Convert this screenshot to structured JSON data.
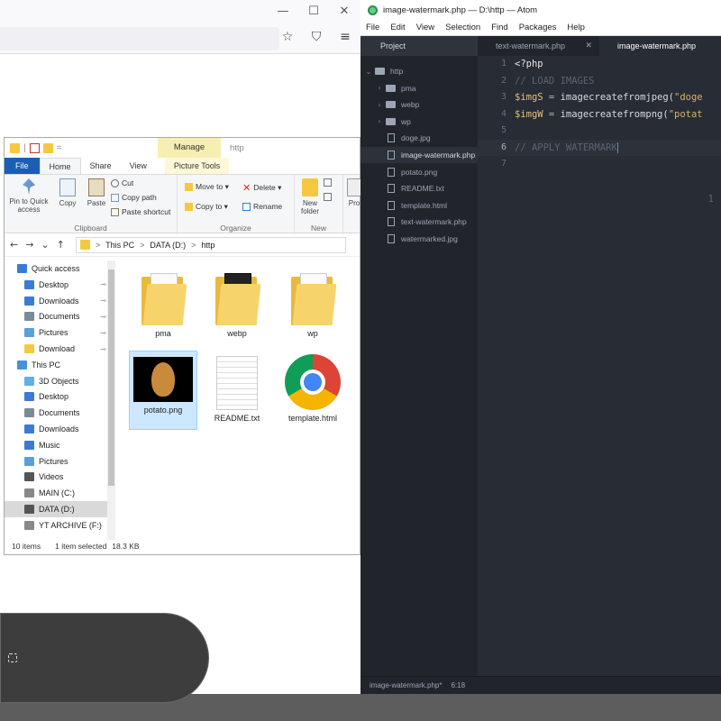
{
  "browser": {
    "win_controls": {
      "minimize": "—",
      "maximize": "☐",
      "close": "✕"
    },
    "nav_icons": [
      "star-icon",
      "pocket-icon",
      "menu-icon"
    ],
    "nav_glyphs": {
      "star": "☆",
      "pocket": "⛉",
      "menu": "≡"
    }
  },
  "explorer": {
    "manage_tab": "Manage",
    "title_path": "http",
    "ribbon_tabs": {
      "file": "File",
      "home": "Home",
      "share": "Share",
      "view": "View",
      "picture_tools": "Picture Tools"
    },
    "clipboard": {
      "pin": "Pin to Quick access",
      "copy": "Copy",
      "paste": "Paste",
      "cut": "Cut",
      "copy_path": "Copy path",
      "paste_shortcut": "Paste shortcut",
      "group": "Clipboard"
    },
    "organize": {
      "move_to": "Move to ▾",
      "copy_to": "Copy to ▾",
      "delete": "Delete ▾",
      "rename": "Rename",
      "group": "Organize"
    },
    "new": {
      "new_folder": "New folder",
      "group": "New"
    },
    "open_partial": "Pro",
    "nav": {
      "back": "←",
      "forward": "→",
      "recent": "⌄",
      "up": "↑"
    },
    "breadcrumb": [
      "This PC",
      "DATA (D:)",
      "http"
    ],
    "crumb_sep": ">",
    "navpane": [
      {
        "label": "Quick access",
        "icon": "star-icon",
        "color": "#3a7bd5",
        "pinned": false
      },
      {
        "label": "Desktop",
        "icon": "desktop-icon",
        "color": "#3a7bd5",
        "pinned": true
      },
      {
        "label": "Downloads",
        "icon": "download-icon",
        "color": "#3a7bd5",
        "pinned": true
      },
      {
        "label": "Documents",
        "icon": "document-icon",
        "color": "#7a8a99",
        "pinned": true
      },
      {
        "label": "Pictures",
        "icon": "pictures-icon",
        "color": "#5aa0d8",
        "pinned": true
      },
      {
        "label": "Download",
        "icon": "folder-icon",
        "color": "#f5c842",
        "pinned": true
      },
      {
        "label": "This PC",
        "icon": "computer-icon",
        "color": "#4a90d9",
        "pinned": false
      },
      {
        "label": "3D Objects",
        "icon": "cube-icon",
        "color": "#5fb0e6",
        "pinned": false
      },
      {
        "label": "Desktop",
        "icon": "desktop-icon",
        "color": "#3a7bd5",
        "pinned": false
      },
      {
        "label": "Documents",
        "icon": "document-icon",
        "color": "#7a8a99",
        "pinned": false
      },
      {
        "label": "Downloads",
        "icon": "download-icon",
        "color": "#3a7bd5",
        "pinned": false
      },
      {
        "label": "Music",
        "icon": "music-icon",
        "color": "#3a7bd5",
        "pinned": false
      },
      {
        "label": "Pictures",
        "icon": "pictures-icon",
        "color": "#5aa0d8",
        "pinned": false
      },
      {
        "label": "Videos",
        "icon": "video-icon",
        "color": "#555555",
        "pinned": false
      },
      {
        "label": "MAIN (C:)",
        "icon": "drive-icon",
        "color": "#888888",
        "pinned": false
      },
      {
        "label": "DATA (D:)",
        "icon": "drive-icon",
        "color": "#555555",
        "pinned": false
      },
      {
        "label": "YT ARCHIVE (F:)",
        "icon": "drive-icon",
        "color": "#888888",
        "pinned": false
      }
    ],
    "pin_glyph": "⊸",
    "files": [
      {
        "name": "pma",
        "kind": "folder"
      },
      {
        "name": "webp",
        "kind": "folder-dark"
      },
      {
        "name": "wp",
        "kind": "folder"
      },
      {
        "name": "potato.png",
        "kind": "image"
      },
      {
        "name": "README.txt",
        "kind": "text"
      },
      {
        "name": "template.html",
        "kind": "chrome"
      }
    ],
    "status": {
      "count": "10 items",
      "selection": "1 item selected",
      "size": "18.3 KB"
    }
  },
  "atom": {
    "title": "image-watermark.php — D:\\http — Atom",
    "menu": [
      "File",
      "Edit",
      "View",
      "Selection",
      "Find",
      "Packages",
      "Help"
    ],
    "project_label": "Project",
    "tree": [
      {
        "label": "http",
        "type": "root"
      },
      {
        "label": "pma",
        "type": "folder"
      },
      {
        "label": "webp",
        "type": "folder"
      },
      {
        "label": "wp",
        "type": "folder"
      },
      {
        "label": "doge.jpg",
        "type": "file"
      },
      {
        "label": "image-watermark.php",
        "type": "file",
        "selected": true
      },
      {
        "label": "potato.png",
        "type": "file"
      },
      {
        "label": "README.txt",
        "type": "file"
      },
      {
        "label": "template.html",
        "type": "file"
      },
      {
        "label": "text-watermark.php",
        "type": "file"
      },
      {
        "label": "watermarked.jpg",
        "type": "file"
      }
    ],
    "tabs": [
      {
        "label": "text-watermark.php",
        "active": false,
        "close": "✕"
      },
      {
        "label": "image-watermark.php",
        "active": true,
        "close": ""
      }
    ],
    "line_numbers": [
      "1",
      "2",
      "3",
      "4",
      "5",
      "6",
      "7"
    ],
    "current_line": 6,
    "code": {
      "l1": "<?php",
      "l2": "// LOAD IMAGES",
      "l3_var": "$imgS",
      "l3_op": " = ",
      "l3_fn": "imagecreatefromjpeg(",
      "l3_str": "\"doge",
      "l4_var": "$imgW",
      "l4_op": " = ",
      "l4_fn": "imagecreatefrompng(",
      "l4_str": "\"potat",
      "l6": "// APPLY WATERMARK"
    },
    "minimap_text": "1",
    "status": {
      "file": "image-watermark.php*",
      "position": "6:18"
    }
  }
}
